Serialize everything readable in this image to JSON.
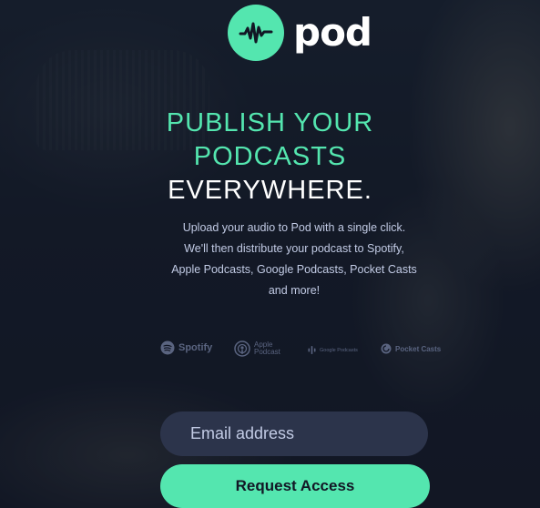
{
  "brand": {
    "name": "pod",
    "accent_color": "#54e6af",
    "logo_icon": "waveform-icon"
  },
  "hero": {
    "headline_line1": "PUBLISH YOUR",
    "headline_line2": "PODCASTS",
    "headline_line3": "EVERYWHERE.",
    "description": "Upload your audio to Pod with a single click. We'll then distribute your podcast to Spotify, Apple Podcasts, Google Podcasts, Pocket Casts and more!"
  },
  "platforms": [
    {
      "name": "Spotify",
      "icon": "spotify-icon"
    },
    {
      "name_line1": "Apple",
      "name_line2": "Podcast",
      "icon": "apple-podcasts-icon"
    },
    {
      "name": "Google Podcasts",
      "icon": "google-podcasts-icon"
    },
    {
      "name": "Pocket Casts",
      "icon": "pocket-casts-icon"
    }
  ],
  "form": {
    "email_placeholder": "Email address",
    "submit_label": "Request Access"
  },
  "colors": {
    "background": "#121725",
    "text_muted": "#c2cbe5",
    "input_bg": "#2c344b",
    "logos": "#5a6480"
  }
}
